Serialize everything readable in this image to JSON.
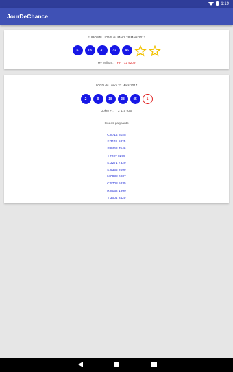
{
  "status_bar": {
    "time": "1:19"
  },
  "app_bar": {
    "title": "JourDeChance"
  },
  "euromillions": {
    "heading": "EURO MILLIONS du Mardi 28 Mars 2017",
    "balls": [
      "6",
      "13",
      "31",
      "32",
      "46"
    ],
    "stars": [
      "",
      ""
    ],
    "my_million_label": "My Million :",
    "my_million_code": "HP 712 4209"
  },
  "loto": {
    "heading": "LOTO du Lundi 27 Mars 2017",
    "balls": [
      "2",
      "9",
      "18",
      "38",
      "45"
    ],
    "lucky": "1",
    "joker_label": "Joker + :",
    "joker_value": "2 115 935",
    "codes_title": "Codes gagnants",
    "codes": [
      "C 8714 8025",
      "F 3141 5825",
      "P 8468 7546",
      "I 7207 0299",
      "K 3271 7329",
      "K 9356 2099",
      "N 0988 6687",
      "C 5708 5835",
      "R 8062 1999",
      "T 3604 2420"
    ]
  },
  "colors": {
    "primary": "#3f51b5",
    "status": "#2f3d99",
    "ball": "#1717e6",
    "star": "#f2c200",
    "accent_red": "#e01b1b",
    "code_text": "#1e2bd6"
  }
}
